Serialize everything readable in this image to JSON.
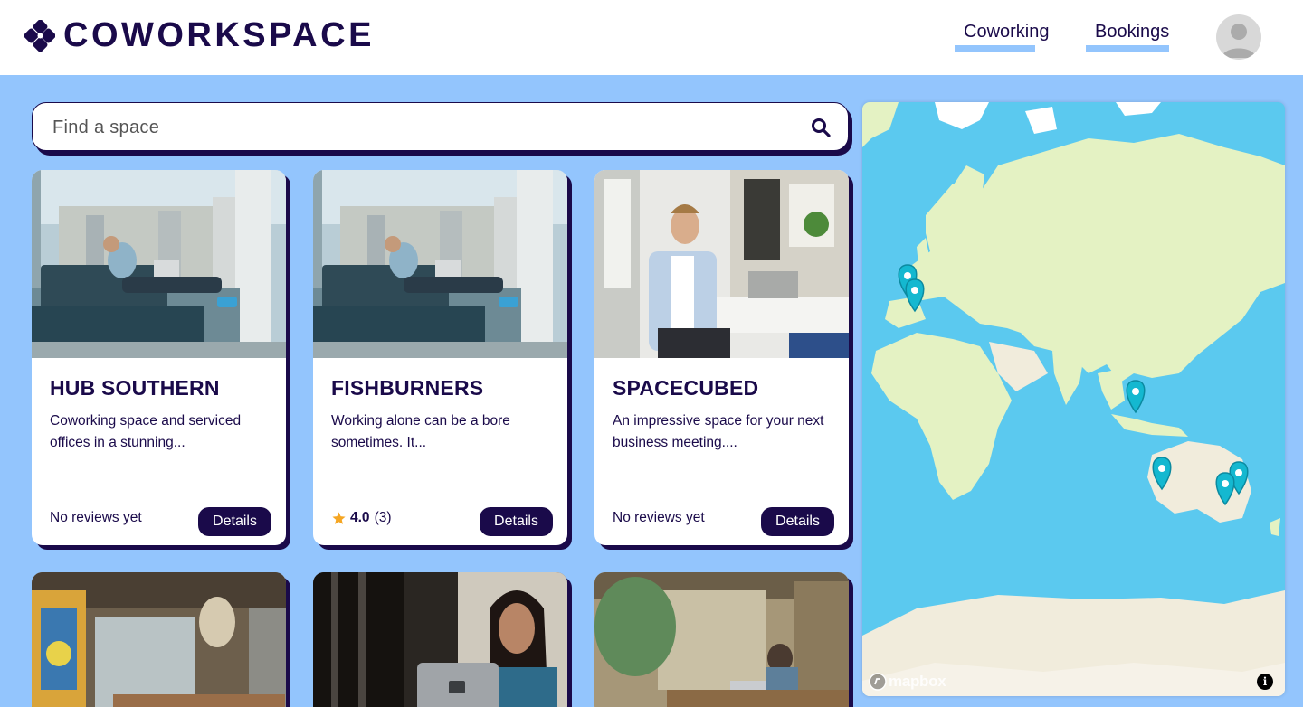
{
  "brand": {
    "name": "COWORKSPACE"
  },
  "nav": {
    "coworking": "Coworking",
    "bookings": "Bookings"
  },
  "search": {
    "placeholder": "Find a space"
  },
  "cards": [
    {
      "title": "HUB SOUTHERN",
      "description": "Coworking space and serviced offices in a stunning...",
      "reviews": "No reviews yet",
      "details_label": "Details"
    },
    {
      "title": "FISHBURNERS",
      "description": "Working alone can be a bore sometimes. It...",
      "rating": "4.0",
      "review_count": "(3)",
      "details_label": "Details"
    },
    {
      "title": "SPACECUBED",
      "description": "An impressive space for your next business meeting....",
      "reviews": "No reviews yet",
      "details_label": "Details"
    }
  ],
  "map": {
    "attribution": "mapbox",
    "info": "i"
  },
  "colors": {
    "navy": "#1a0a4a",
    "background": "#93c5fd",
    "ocean": "#5bc9ef",
    "land": "#e4f2c3",
    "marker": "#14b8d0"
  }
}
